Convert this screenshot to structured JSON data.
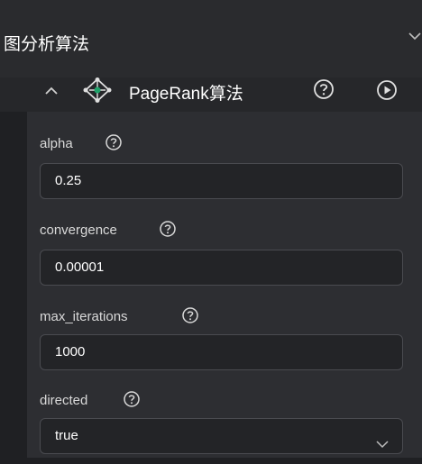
{
  "section": {
    "title": "图分析算法"
  },
  "algorithm": {
    "title": "PageRank算法"
  },
  "params": [
    {
      "label": "alpha",
      "value": "0.25"
    },
    {
      "label": "convergence",
      "value": "0.00001"
    },
    {
      "label": "max_iterations",
      "value": "1000"
    },
    {
      "label": "directed",
      "value": "true"
    }
  ],
  "colors": {
    "background": "#1f2023",
    "panel": "#2d2e32",
    "border": "#4a4b50"
  },
  "icons": {
    "section_toggle": "chevron-down-icon",
    "collapse": "chevron-up-icon",
    "algorithm": "graph-network-icon",
    "help": "question-circle-icon",
    "run": "play-circle-icon",
    "select": "chevron-down-icon"
  }
}
